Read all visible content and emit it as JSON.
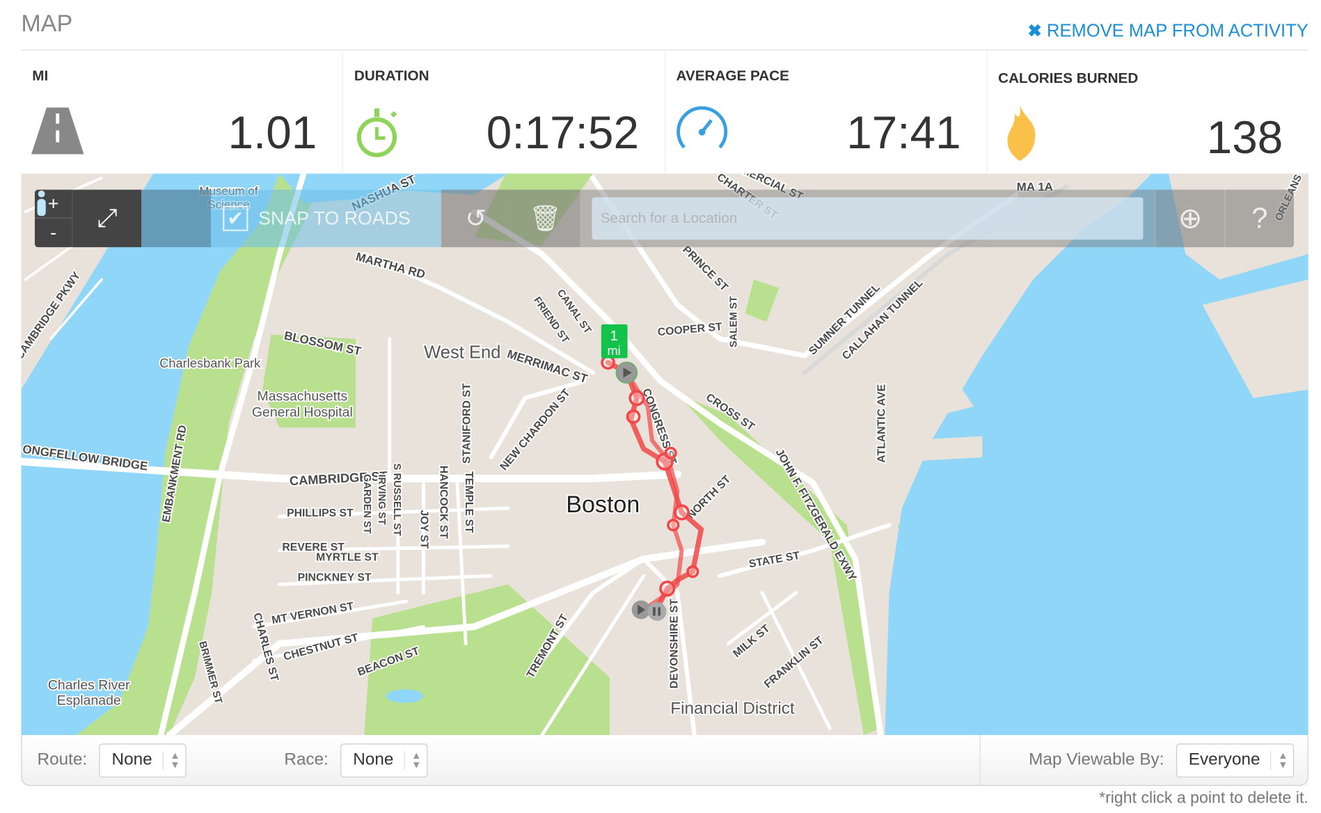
{
  "header": {
    "title": "MAP",
    "remove_label": "REMOVE MAP FROM ACTIVITY",
    "remove_icon": "close-x-icon",
    "accent": "#1a8fd6"
  },
  "stats": [
    {
      "label": "MI",
      "value": "1.01",
      "icon": "road-icon",
      "color": "#888888"
    },
    {
      "label": "DURATION",
      "value": "0:17:52",
      "icon": "stopwatch-icon",
      "color": "#8ed35a"
    },
    {
      "label": "AVERAGE PACE",
      "value": "17:41",
      "icon": "speedometer-icon",
      "color": "#3a9fe0"
    },
    {
      "label": "CALORIES BURNED",
      "value": "138",
      "icon": "flame-icon",
      "color": "#f9c04a"
    }
  ],
  "toolbar": {
    "zoom_in": "+",
    "zoom_out": "-",
    "snap_label": "SNAP TO ROADS",
    "snap_checked": true,
    "search_placeholder": "Search for a Location",
    "help": "?"
  },
  "map": {
    "marker_label": "1",
    "marker_unit": "mi",
    "route_color": "#f04848",
    "labels": [
      "Museum of",
      "Science",
      "NASHUA ST",
      "MARTHA RD",
      "CANAL ST",
      "FRIEND ST",
      "West End",
      "MERRIMAC ST",
      "BLOSSOM ST",
      "Charlesbank Park",
      "Massachusetts",
      "General Hospital",
      "ONGFELLOW BRIDGE",
      "EMBANKMENT RD",
      "CAMBRIDGE ST",
      "STANIFORD ST",
      "NEW CHARDON ST",
      "Boston",
      "PHILLIPS ST",
      "REVERE ST",
      "MYRTLE ST",
      "PINCKNEY ST",
      "MT VERNON ST",
      "CHESTNUT ST",
      "BEACON ST",
      "CHARLES ST",
      "BRIMMER ST",
      "Charles River",
      "Esplanade",
      "TREMONT ST",
      "DEVONSHIRE ST",
      "Financial District",
      "MILK ST",
      "FRANKLIN ST",
      "STATE ST",
      "NORTH ST",
      "CROSS ST",
      "JOHN F. FITZGERALD EXWY",
      "ATLANTIC AVE",
      "SUMNER TUNNEL",
      "CALLAHAN TUNNEL",
      "COOPER ST",
      "SALEM ST",
      "PRINCE ST",
      "CHARTER ST",
      "MERCIAL ST",
      "MA 1A",
      "CAMBRIDGE PKWY",
      "JOY ST",
      "HANCOCK ST",
      "TEMPLE ST",
      "GARDEN ST",
      "IRVING ST",
      "S RUSSELL ST",
      "CONGRESS ST",
      "ORLEANS"
    ]
  },
  "footer": {
    "route_label": "Route:",
    "route_value": "None",
    "race_label": "Race:",
    "race_value": "None",
    "viewable_label": "Map Viewable By:",
    "viewable_value": "Everyone",
    "note": "*right click a point to delete it."
  }
}
